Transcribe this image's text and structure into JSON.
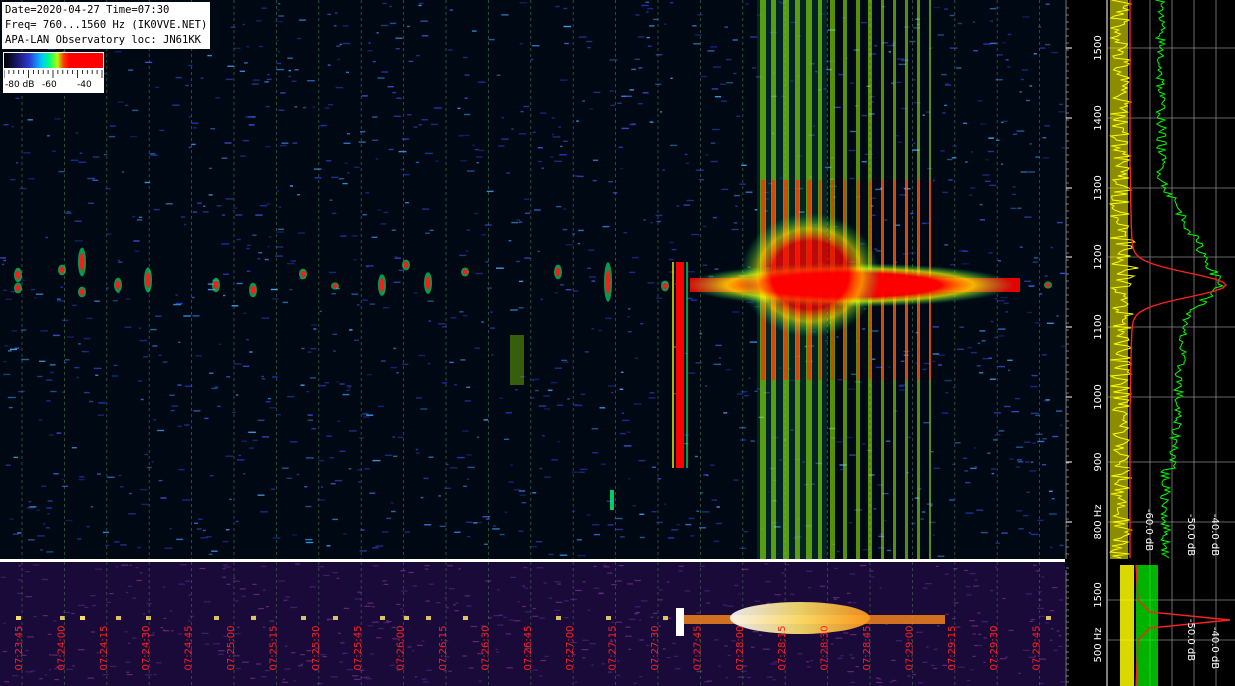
{
  "header": {
    "line1": "Date=2020-04-27 Time=07:30",
    "line2": "Freq= 760...1560 Hz (IK0VVE.NET)",
    "line3": "APA-LAN Observatory loc: JN61KK"
  },
  "color_scale": {
    "labels": [
      "-80 dB",
      "-60",
      "-40"
    ],
    "colors": [
      "#1a1a6e",
      "#2d3bd8",
      "#00c8ff",
      "#00ff7a",
      "#b6ff00",
      "#ffff00",
      "#ff3a00",
      "#ff0000"
    ]
  },
  "freq_axis": {
    "ticks": [
      "800 Hz",
      "900",
      "1000",
      "1100",
      "1200",
      "1300",
      "1400",
      "1500"
    ]
  },
  "small_freq_axis": {
    "ticks": [
      "500 Hz",
      "1500"
    ]
  },
  "time_axis": {
    "ticks": [
      "07:23:45",
      "07:24:00",
      "07:24:15",
      "07:24:30",
      "07:24:45",
      "07:25:00",
      "07:25:15",
      "07:25:30",
      "07:25:45",
      "07:26:00",
      "07:26:15",
      "07:26:30",
      "07:26:45",
      "07:27:00",
      "07:27:15",
      "07:27:30",
      "07:27:45",
      "07:28:00",
      "07:28:15",
      "07:28:30",
      "07:28:45",
      "07:29:00",
      "07:29:15",
      "07:29:30",
      "07:29:45"
    ]
  },
  "spectrum_axis": {
    "labels": [
      "-60.0 dB",
      "-50.0 dB",
      "-40.0 dB"
    ]
  },
  "colors": {
    "spectrum_yellow": "#ffff00",
    "spectrum_green": "#00ff00",
    "spectrum_red": "#ff2020",
    "time_label": "#ff2020",
    "grid": "#3a7a3a"
  }
}
